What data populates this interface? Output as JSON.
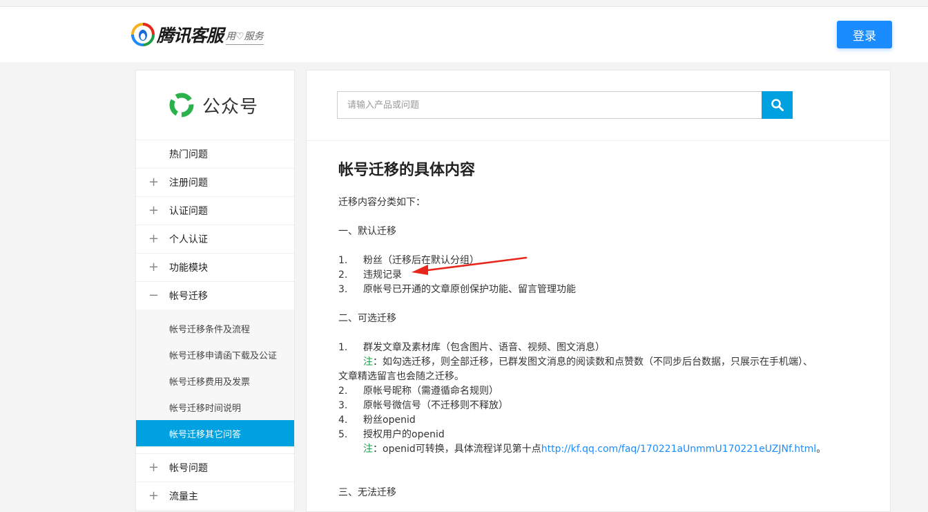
{
  "header": {
    "logo_text": "腾讯客服",
    "logo_slogan": "用♡服务",
    "login_label": "登录"
  },
  "sidebar": {
    "product_name": "公众号",
    "items": [
      {
        "label": "热门问题",
        "sign": ""
      },
      {
        "label": "注册问题",
        "sign": "+"
      },
      {
        "label": "认证问题",
        "sign": "+"
      },
      {
        "label": "个人认证",
        "sign": "+"
      },
      {
        "label": "功能模块",
        "sign": "+"
      },
      {
        "label": "帐号迁移",
        "sign": "−"
      }
    ],
    "sub_items": [
      "帐号迁移条件及流程",
      "帐号迁移申请函下载及公证",
      "帐号迁移费用及发票",
      "帐号迁移时间说明",
      "帐号迁移其它问答"
    ],
    "items_after": [
      {
        "label": "帐号问题",
        "sign": "+"
      },
      {
        "label": "流量主",
        "sign": "+"
      }
    ]
  },
  "search": {
    "placeholder": "请输入产品或问题"
  },
  "article": {
    "title": "帐号迁移的具体内容",
    "intro": "迁移内容分类如下：",
    "section1_title": "一、默认迁移",
    "section1_items": [
      {
        "num": "1.",
        "text": "粉丝（迁移后在默认分组）"
      },
      {
        "num": "2.",
        "text": "违规记录"
      },
      {
        "num": "3.",
        "text": "原帐号已开通的文章原创保护功能、留言管理功能"
      }
    ],
    "section2_title": "二、可选迁移",
    "section2_item1": {
      "num": "1.",
      "text": "群发文章及素材库（包含图片、语音、视频、图文消息）"
    },
    "note1_tag": "注",
    "note1_text": "：如勾选迁移，则全部迁移，已群发图文消息的阅读数和点赞数（不同步后台数据，只展示在手机端）、",
    "note1_cont": "文章精选留言也会随之迁移。",
    "section2_items_rest": [
      {
        "num": "2.",
        "text": "原帐号昵称（需遵循命名规则）"
      },
      {
        "num": "3.",
        "text": "原帐号微信号（不迁移则不释放）"
      },
      {
        "num": "4.",
        "text": "粉丝openid"
      },
      {
        "num": "5.",
        "text": "授权用户的openid"
      }
    ],
    "note2_tag": "注",
    "note2_text": "：openid可转换，具体流程详见第十点",
    "note2_link": "http://kf.qq.com/faq/170221aUnmmU170221eUZJNf.html",
    "note2_end": "。",
    "section3_title": "三、无法迁移"
  },
  "colors": {
    "accent_blue": "#00a1e0",
    "login_blue": "#1a8cff",
    "annotation_red": "#e8261c",
    "note_green": "#1a9e4a"
  }
}
